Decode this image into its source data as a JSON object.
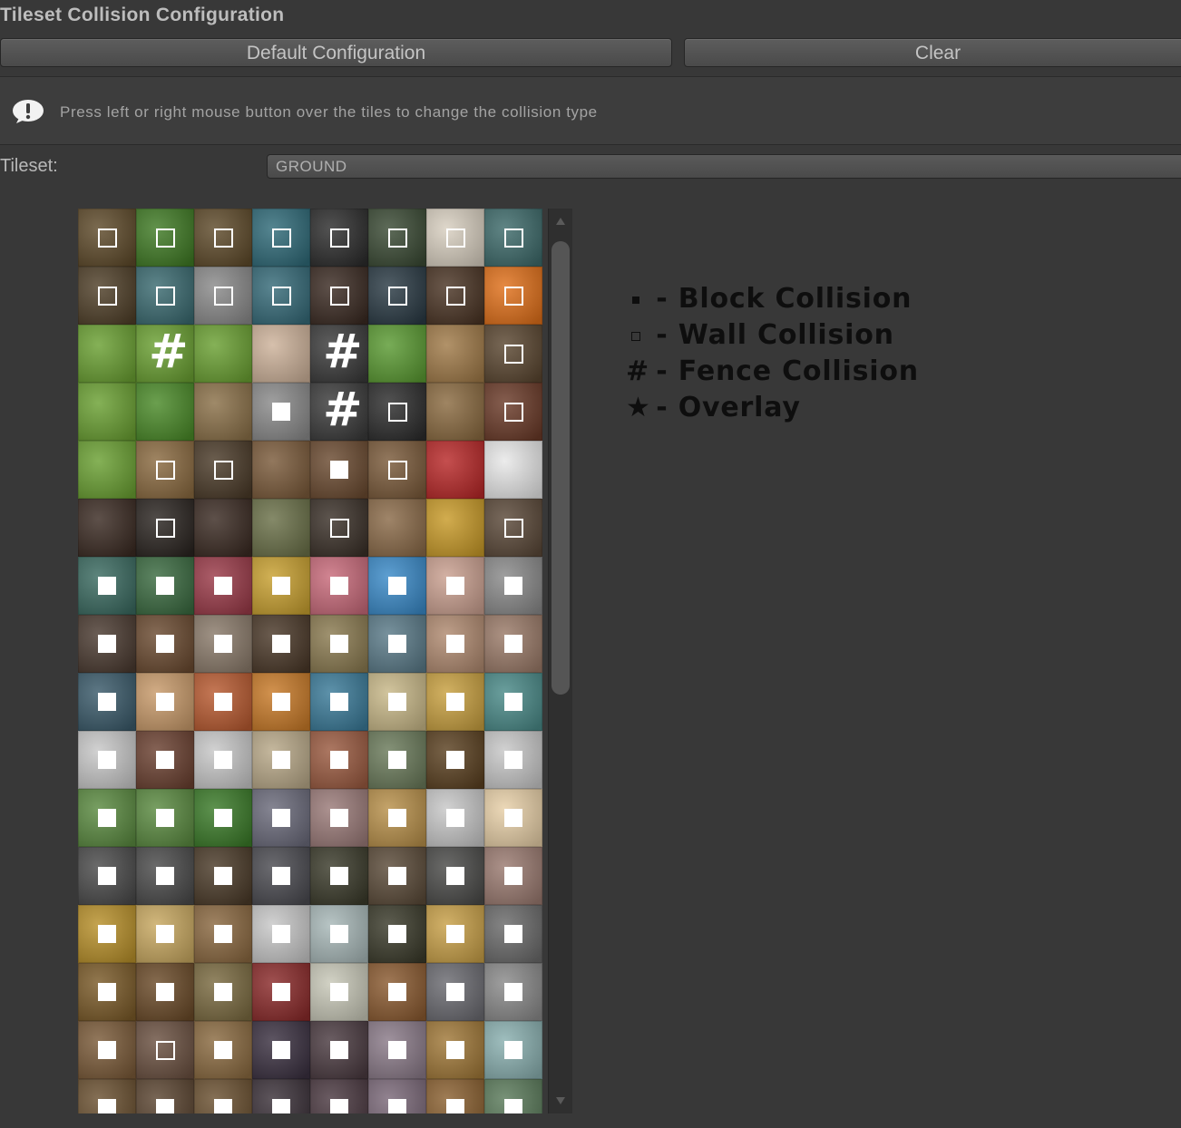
{
  "header": {
    "title": "Tileset Collision Configuration",
    "default_button": "Default Configuration",
    "clear_button": "Clear"
  },
  "help": {
    "icon": "exclamation-bubble-icon",
    "text": "Press left or right mouse button over the tiles to change the collision type"
  },
  "tileset": {
    "label": "Tileset:",
    "value": "GROUND"
  },
  "legend": {
    "block": "- Block Collision",
    "wall": "- Wall Collision",
    "fence": "- Fence Collision",
    "overlay": "- Overlay",
    "block_icon": "filled-square-icon",
    "wall_icon": "hollow-square-icon",
    "fence_symbol": "#",
    "overlay_symbol": "★"
  },
  "colors": {
    "background": "#383838",
    "marker": "#ffffff",
    "legend_text": "#0e0e0e"
  },
  "tiles": {
    "columns": 8,
    "rows": [
      {
        "c": [
          "#5e4a2a",
          "#3f7a24",
          "#5e4a2a",
          "#2f6a78",
          "#2c2c2c",
          "#3a4a34",
          "#d8cfc0",
          "#3d6a6a"
        ],
        "m": [
          "W",
          "W",
          "W",
          "W",
          "W",
          "W",
          "W",
          "W"
        ]
      },
      {
        "c": [
          "#4f3f28",
          "#3a6a70",
          "#8a8a8a",
          "#356a78",
          "#3a2a22",
          "#2a3a44",
          "#4a3424",
          "#e0701a"
        ],
        "m": [
          "W",
          "W",
          "W",
          "W",
          "W",
          "W",
          "W",
          "W"
        ]
      },
      {
        "c": [
          "#6aa032",
          "#6aa032",
          "#6aa032",
          "#cdb29a",
          "#3a3a3a",
          "#5a9a32",
          "#a07a48",
          "#5a4630"
        ],
        "m": [
          "",
          "F",
          "",
          "",
          "F",
          "",
          "",
          "W"
        ]
      },
      {
        "c": [
          "#6aa032",
          "#4a8a28",
          "#8a7048",
          "#8a8a8a",
          "#3a3a3a",
          "#2c2c2c",
          "#8a6a40",
          "#6a3a28"
        ],
        "m": [
          "",
          "",
          "",
          "B",
          "F",
          "W",
          "",
          "W"
        ]
      },
      {
        "c": [
          "#6aa032",
          "#8a6a40",
          "#4a3a28",
          "#7a5a3a",
          "#6a4a30",
          "#7a5a3a",
          "#b82828",
          "#e8e8e8"
        ],
        "m": [
          "",
          "W",
          "W",
          "",
          "B",
          "W",
          "",
          ""
        ]
      },
      {
        "c": [
          "#3a2a22",
          "#2a2420",
          "#3a2a22",
          "#6a7048",
          "#3a3028",
          "#8a6a48",
          "#c89a28",
          "#5a4838"
        ],
        "m": [
          "",
          "W",
          "",
          "",
          "W",
          "",
          "",
          "W"
        ]
      },
      {
        "c": [
          "#3a6a60",
          "#3a6a40",
          "#9a3a48",
          "#c8a030",
          "#c86a7a",
          "#3a8ac8",
          "#caa090",
          "#8a8a8a"
        ],
        "m": [
          "B",
          "B",
          "B",
          "B",
          "B",
          "B",
          "B",
          "B"
        ]
      },
      {
        "c": [
          "#4a3a30",
          "#6a4a30",
          "#8a7a6a",
          "#4a3828",
          "#8a7a50",
          "#5a7a88",
          "#b08a70",
          "#9a7a68"
        ],
        "m": [
          "B",
          "B",
          "B",
          "B",
          "B",
          "B",
          "B",
          "B"
        ]
      },
      {
        "c": [
          "#3a5a6a",
          "#c89a6a",
          "#b85a30",
          "#c87a28",
          "#3a7a98",
          "#c8b888",
          "#c8a040",
          "#4a8a88"
        ],
        "m": [
          "B",
          "B",
          "B",
          "B",
          "B",
          "B",
          "B",
          "B"
        ]
      },
      {
        "c": [
          "#c8c8c8",
          "#6a4030",
          "#c8c8c8",
          "#b8a888",
          "#9a5a40",
          "#6a7a5a",
          "#5a4020",
          "#c8c8c8"
        ],
        "m": [
          "B",
          "B",
          "B",
          "B",
          "B",
          "B",
          "B",
          "B"
        ]
      },
      {
        "c": [
          "#5a8a40",
          "#5a8a40",
          "#3a7a28",
          "#6a6a7a",
          "#9a7a78",
          "#b8904a",
          "#c8c8c8",
          "#e8d0a8"
        ],
        "m": [
          "B",
          "B",
          "B",
          "B",
          "B",
          "B",
          "B",
          "B"
        ]
      },
      {
        "c": [
          "#4a4a4a",
          "#4a4a4a",
          "#4a3a28",
          "#4a4a50",
          "#3a3a2a",
          "#5a4a38",
          "#4a4a48",
          "#9a7a70"
        ],
        "m": [
          "B",
          "B",
          "B",
          "B",
          "B",
          "B",
          "B",
          "B"
        ]
      },
      {
        "c": [
          "#b8902a",
          "#c8a860",
          "#8a6840",
          "#c8c8c8",
          "#a8b8b8",
          "#3a3a2a",
          "#c8a048",
          "#6a6a6a"
        ],
        "m": [
          "B",
          "B",
          "B",
          "B",
          "B",
          "B",
          "B",
          "B"
        ]
      },
      {
        "c": [
          "#7a5a28",
          "#6a4a28",
          "#7a6a40",
          "#8a2a2a",
          "#c8c8b8",
          "#8a5a30",
          "#6a6a70",
          "#8a8a8a"
        ],
        "m": [
          "B",
          "B",
          "B",
          "B",
          "B",
          "B",
          "B",
          "B"
        ]
      },
      {
        "c": [
          "#7a5a38",
          "#6a5040",
          "#8a6a40",
          "#3a3040",
          "#4a3a40",
          "#8a7a88",
          "#a07838",
          "#8ab0b0"
        ],
        "m": [
          "B",
          "W",
          "B",
          "B",
          "B",
          "B",
          "B",
          "B"
        ]
      },
      {
        "c": [
          "#6a5030",
          "#5a4430",
          "#6a5030",
          "#3a3038",
          "#4a3840",
          "#7a6878",
          "#8a6030",
          "#5a7a5a"
        ],
        "m": [
          "B",
          "B",
          "B",
          "B",
          "B",
          "B",
          "B",
          "B"
        ]
      }
    ]
  }
}
